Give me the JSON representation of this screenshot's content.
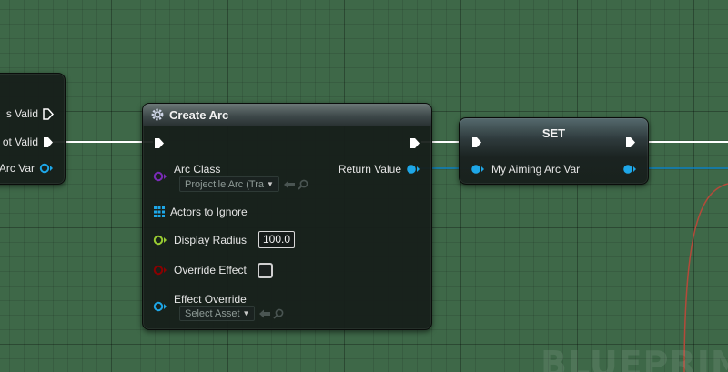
{
  "graph": {
    "watermark": "BLUEPRINT"
  },
  "left_node": {
    "pin1_label": "s Valid",
    "pin2_label": "ot Valid",
    "pin3_label": "rc Arc Var"
  },
  "create_arc": {
    "title": "Create Arc",
    "icon": "gear-icon",
    "arc_class_label": "Arc Class",
    "arc_class_value": "Projectile Arc (Tra",
    "return_value_label": "Return Value",
    "actors_label": "Actors to Ignore",
    "display_radius_label": "Display Radius",
    "display_radius_value": "100.0",
    "override_effect_label": "Override Effect",
    "effect_override_label": "Effect Override",
    "effect_override_value": "Select Asset"
  },
  "set_node": {
    "title": "SET",
    "var_label": "My Aiming Arc Var"
  },
  "colors": {
    "exec": "#ffffff",
    "object_pin": "#1ea7e8",
    "class_pin": "#7a2bb8",
    "float_pin": "#9acd32",
    "bool_pin": "#8b0000",
    "array_pin": "#1ea7e8",
    "wire_blue": "#0a7fbf",
    "wire_red": "#b34a3a"
  }
}
